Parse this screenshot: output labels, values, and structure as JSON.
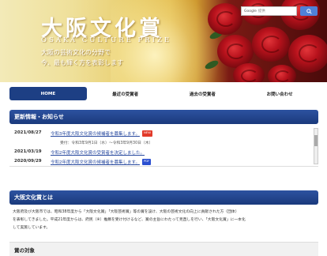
{
  "header": {
    "title": "大阪文化賞",
    "subtitle": "OSAKA CULTURE PRIZE",
    "tagline": [
      "大阪の芸術文化の分野で",
      "今、最も輝く方を表彰します"
    ]
  },
  "search": {
    "placeholder": "Google",
    "placeholder_suffix": "提供",
    "button_icon": "search-icon"
  },
  "nav": [
    {
      "label": "HOME",
      "active": true
    },
    {
      "label": "最近の受賞者",
      "active": false
    },
    {
      "label": "過去の受賞者",
      "active": false
    },
    {
      "label": "お問い合わせ",
      "active": false
    }
  ],
  "news": {
    "heading": "更新情報・お知らせ",
    "items": [
      {
        "date": "2021/08/27",
        "text": "令和3年度大阪文化賞の候補者を募集します。",
        "badge": "NEW",
        "sub": "受付：令和3年9月1日（水）～令和3年9月30日（木）"
      },
      {
        "date": "2021/03/19",
        "text": "令和2年度大阪文化賞の受賞者を決定しました。",
        "badge": ""
      },
      {
        "date": "2020/09/29",
        "text": "令和2年度大阪文化賞の候補者を募集します。",
        "badge": "PDF"
      }
    ]
  },
  "about": {
    "heading": "大阪文化賞とは",
    "lines": [
      "大阪府及び大阪市では、昭和38年度から「大阪文化賞」「大阪芸術賞」等の賞を設け、大阪の芸術文化の向上に貢献された方（団体）",
      "を表彰してきました。平成21年度からは、府民（※）推薦を受け付けるなど、賞の主旨にわたって見直しを行い、「大阪文化賞」に一本化",
      "して実施しています。"
    ]
  },
  "targets": {
    "heading": "賞の対象"
  },
  "colors": {
    "nav_active": "#1d3f84",
    "section_bar": "#1a3a7c",
    "link": "#2a4ba0",
    "badge_new": "#e23a2a",
    "badge_pdf": "#2b4fd0"
  }
}
